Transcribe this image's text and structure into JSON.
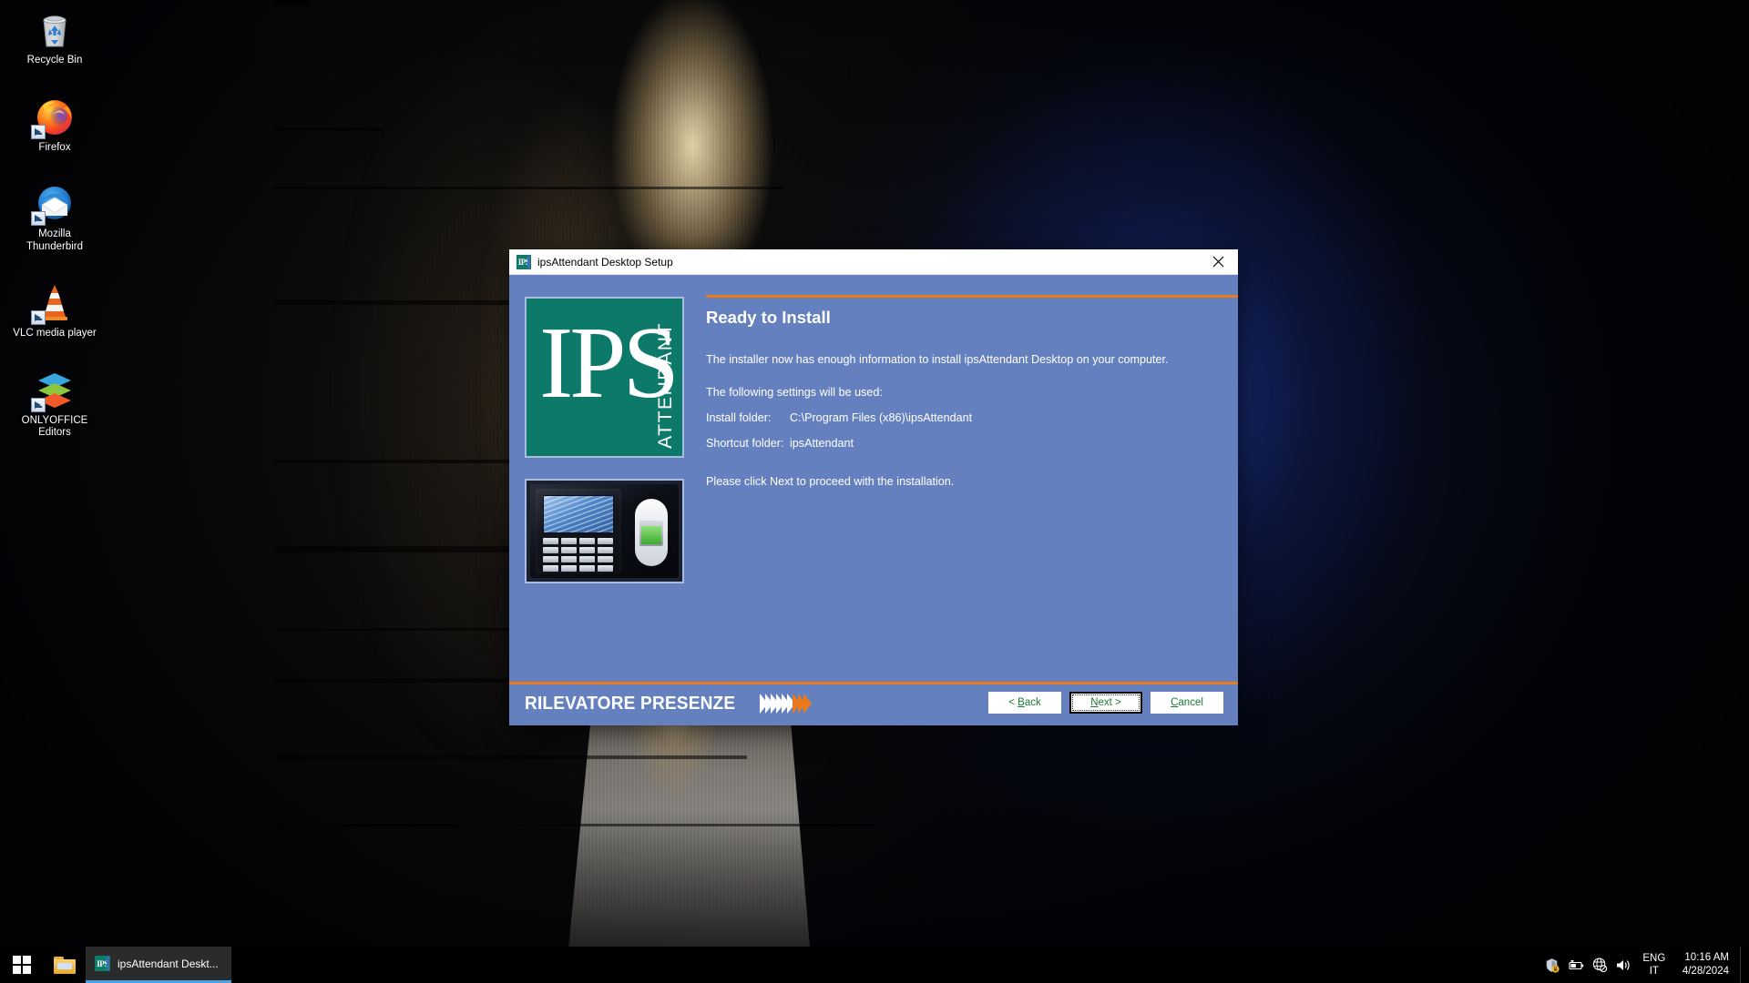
{
  "desktop": {
    "icons": [
      {
        "label": "Recycle Bin",
        "icon": "recycle-bin-icon",
        "shortcut": false
      },
      {
        "label": "Firefox",
        "icon": "firefox-icon",
        "shortcut": true
      },
      {
        "label": "Mozilla Thunderbird",
        "icon": "thunderbird-icon",
        "shortcut": true
      },
      {
        "label": "VLC media player",
        "icon": "vlc-icon",
        "shortcut": true
      },
      {
        "label": "ONLYOFFICE Editors",
        "icon": "onlyoffice-icon",
        "shortcut": true
      }
    ]
  },
  "installer": {
    "window_title": "ipsAttendant Desktop Setup",
    "window_icon": "ips-app-icon",
    "close_icon": "close-icon",
    "page_title": "Ready to Install",
    "intro": "The installer now has enough information to install ipsAttendant Desktop on your computer.",
    "settings_lead": "The following settings will be used:",
    "rows": [
      {
        "label": "Install folder:",
        "value": "C:\\Program Files (x86)\\ipsAttendant"
      },
      {
        "label": "Shortcut folder:",
        "value": "ipsAttendant"
      }
    ],
    "closing": "Please click Next to proceed with the installation.",
    "logo": {
      "mark": "IPS",
      "wordmark": "ATTENDANT",
      "device_image": "attendance-terminal-photo"
    },
    "brand_banner": "RILEVATORE PRESENZE",
    "buttons": [
      {
        "name": "back",
        "pre": "< ",
        "accel": "B",
        "post": "ack",
        "default": false
      },
      {
        "name": "next",
        "pre": "",
        "accel": "N",
        "post": "ext >",
        "default": true
      },
      {
        "name": "cancel",
        "pre": "",
        "accel": "C",
        "post": "ancel",
        "default": false
      }
    ],
    "colors": {
      "dialog_bg": "#6580bf",
      "accent_orange": "#ec7a1c",
      "logo_teal": "#0d7a69",
      "button_text_green": "#1c7a2e"
    }
  },
  "taskbar": {
    "start_icon": "windows-start-icon",
    "explorer_icon": "file-explorer-icon",
    "task_item": {
      "label": "ipsAttendant Deskt...",
      "icon": "ips-app-icon"
    },
    "tray_icons": [
      "security-shield-icon",
      "battery-icon",
      "network-globe-icon",
      "volume-icon"
    ],
    "language": {
      "line1": "ENG",
      "line2": "IT"
    },
    "clock": {
      "time": "10:16 AM",
      "date": "4/28/2024"
    }
  }
}
